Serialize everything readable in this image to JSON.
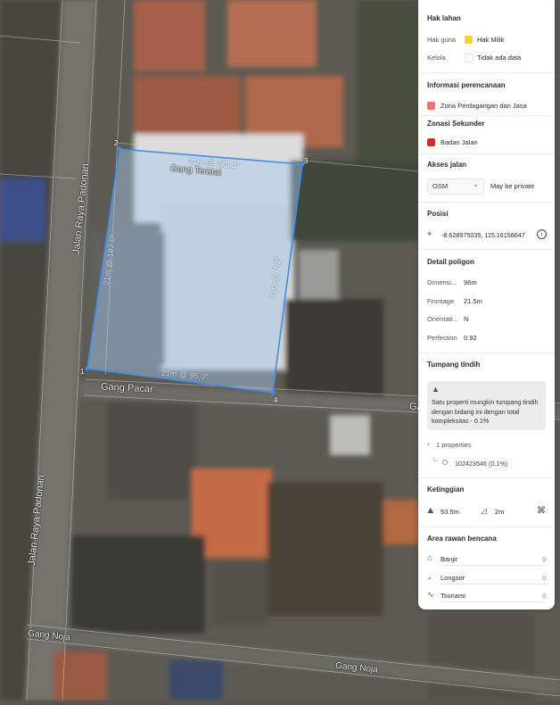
{
  "map": {
    "roads": {
      "jalan_raya_padonan_top": "Jalan Raya Padonan",
      "jalan_raya_padonan_bottom": "Jalan Raya Padonan",
      "gang_teratai": "Gang Teratai",
      "gang_pacar": "Gang Pacar",
      "gang_pacar_right": "Ga",
      "gang_noja_left": "Gang Noja",
      "gang_noja_right": "Gang Noja"
    },
    "dimensions": {
      "top": "21m @ 275.0°",
      "right": "21m @ 7.2°",
      "bottom": "21m @ 95.0°",
      "left": "21m @ 187.0°"
    },
    "vertices": {
      "v1": "1",
      "v2": "2",
      "v3": "3",
      "v4": "4"
    },
    "colors": {
      "polygon_stroke": "#3d8ee8",
      "polygon_fill": "#a9c9ee"
    }
  },
  "panel": {
    "hak_lahan": {
      "title": "Hak lahan",
      "rows": [
        {
          "label": "Hak guna",
          "value": "Hak Milik",
          "color": "#f3d23a"
        },
        {
          "label": "Kelola",
          "value": "Tidak ada data",
          "color": "#ffffff"
        }
      ]
    },
    "informasi": {
      "title": "Informasi perencanaan",
      "zona": {
        "value": "Zona Perdagangan dan Jasa",
        "color": "#f07373"
      }
    },
    "zonasi": {
      "title": "Zonasi Sekunder",
      "value": "Badan Jalan",
      "color": "#e0262b"
    },
    "akses": {
      "title": "Akses jalan",
      "select_value": "OSM",
      "select_icon": "chevron-down-icon",
      "status": "May be private"
    },
    "posisi": {
      "title": "Posisi",
      "coords": "-8.628975035, 115.16158647",
      "icon": "crosshair-icon",
      "info_icon": "info-icon"
    },
    "detail": {
      "title": "Detail poligon",
      "rows": [
        {
          "label": "Dimensi...",
          "value": "96m"
        },
        {
          "label": "Frontage",
          "value": "21.5m"
        },
        {
          "label": "Orientati...",
          "value": "N"
        },
        {
          "label": "Perfection",
          "value": "0.92"
        }
      ]
    },
    "tumpang": {
      "title": "Tumpang tindih",
      "warning": "Satu properti mungkin tumpang tindih dengan bidang ini dengan total kompleksitas - 0.1%",
      "properties_label": "1 properties",
      "property_id": "102423546 (0.1%)"
    },
    "ketinggian": {
      "title": "Ketinggian",
      "height": "53.5m",
      "slope": "2m"
    },
    "bencana": {
      "title": "Area rawan bencana",
      "rows": [
        {
          "label": "Banjir",
          "value": "0"
        },
        {
          "label": "Longsor",
          "value": "0"
        },
        {
          "label": "Tsunami",
          "value": "0"
        }
      ]
    }
  }
}
